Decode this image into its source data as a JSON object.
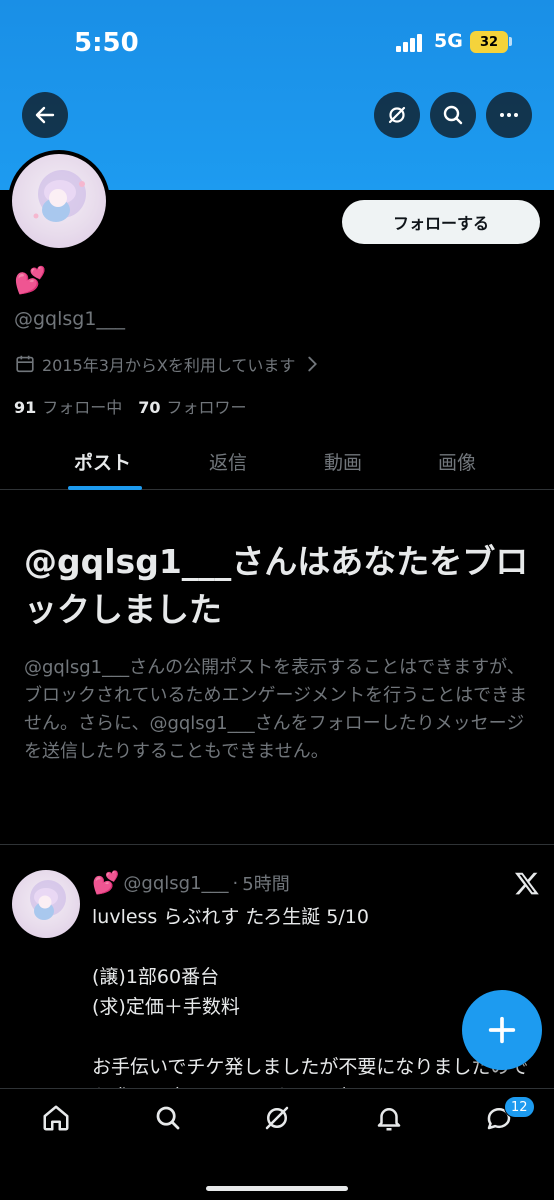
{
  "status_bar": {
    "time": "5:50",
    "network": "5G",
    "battery": "32"
  },
  "profile": {
    "display_name": "💕",
    "handle": "@gqlsg1___",
    "joined": "2015年3月からXを利用しています",
    "following_count": "91",
    "following_label": "フォロー中",
    "followers_count": "70",
    "followers_label": "フォロワー",
    "follow_button": "フォローする"
  },
  "tabs": [
    {
      "label": "ポスト",
      "active": true
    },
    {
      "label": "返信",
      "active": false
    },
    {
      "label": "動画",
      "active": false
    },
    {
      "label": "画像",
      "active": false
    }
  ],
  "blocked": {
    "title": "@gqlsg1___さんはあなたをブロックしました",
    "body": "@gqlsg1___さんの公開ポストを表示することはできますが、ブロックされているためエンゲージメントを行うことはできません。さらに、@gqlsg1___さんをフォローしたりメッセージを送信したりすることもできません。"
  },
  "post": {
    "name": "💕",
    "handle": "@gqlsg1___",
    "separator": "·",
    "time": "5時間",
    "text": "luvless らぶれす たろ生誕 5/10\n\n(譲)1部60番台\n(求)定価＋手数料\n\nお手伝いでチケ発しましたが不要になりましたのでお求めの方はDMまでお願い致します"
  },
  "nav": {
    "messages_badge": "12"
  },
  "colors": {
    "accent": "#1d9bf0",
    "background": "#000000",
    "secondary_text": "#71767b"
  }
}
